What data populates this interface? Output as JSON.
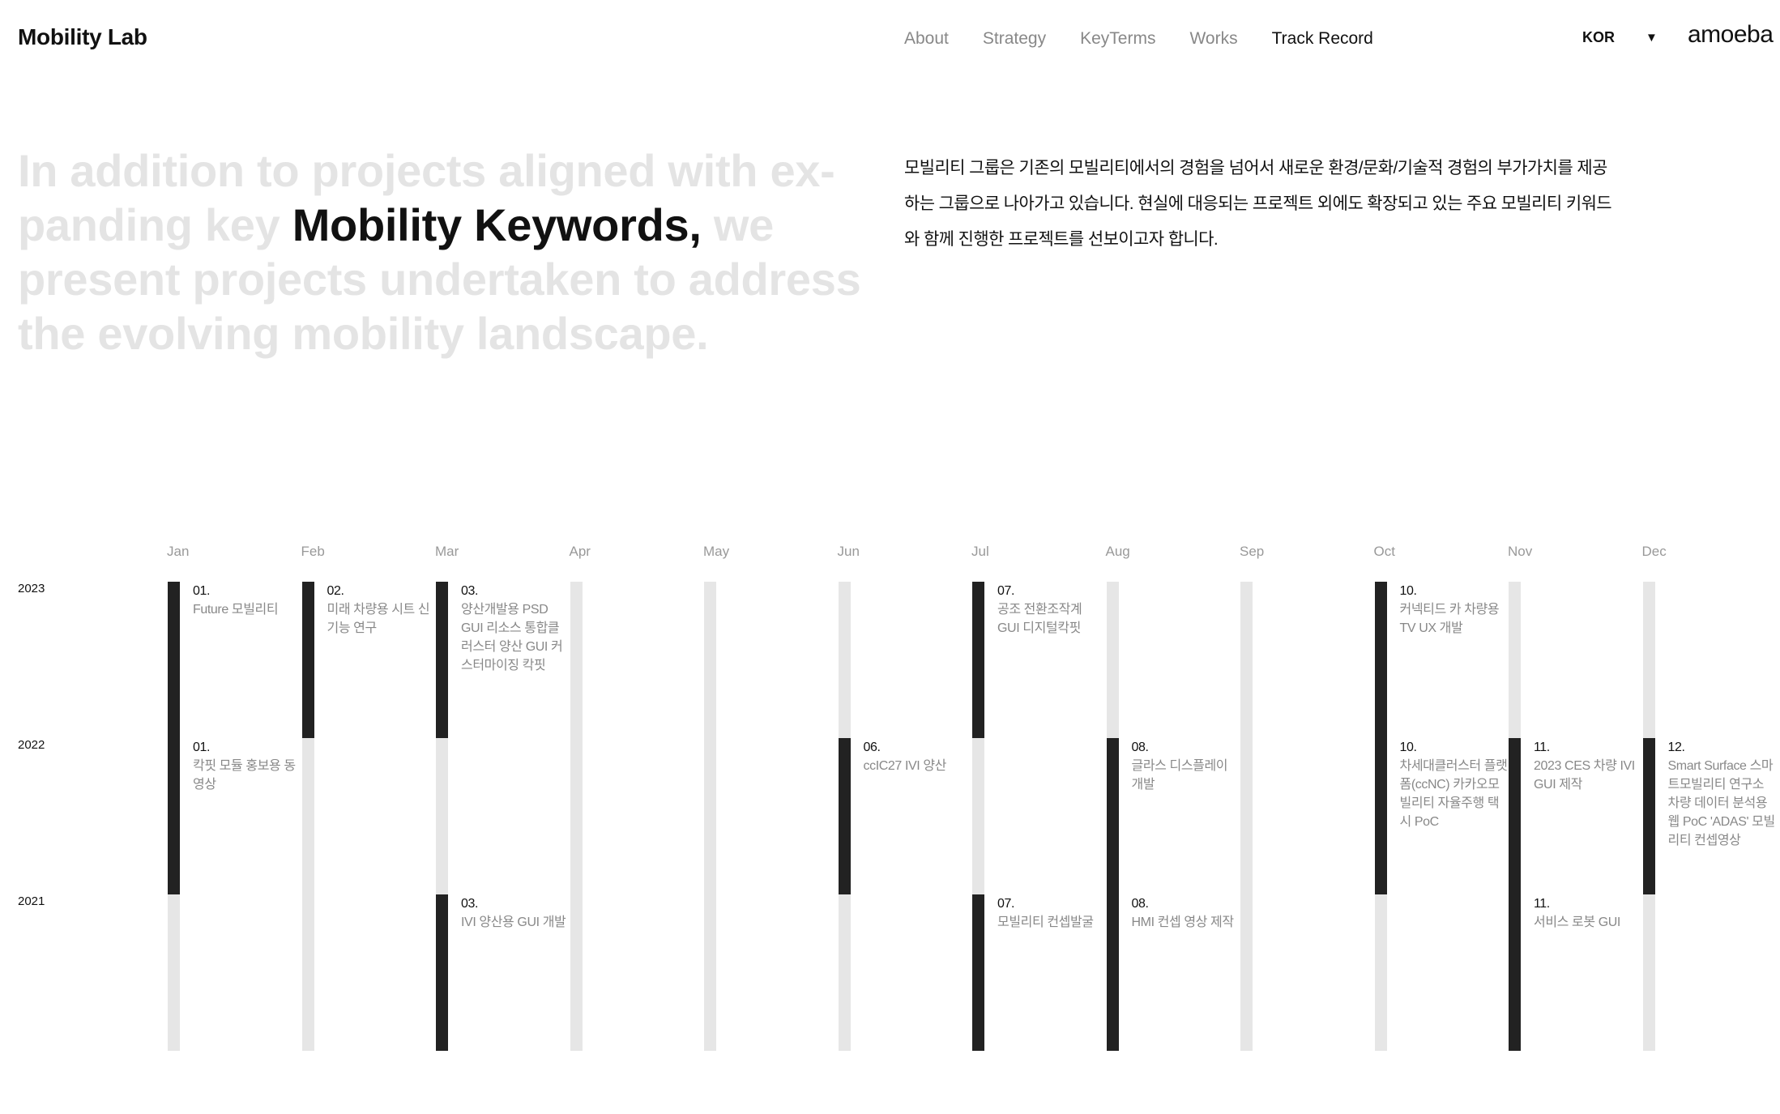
{
  "header": {
    "logo": "Mobility Lab",
    "nav": [
      {
        "label": "About",
        "active": false
      },
      {
        "label": "Strategy",
        "active": false
      },
      {
        "label": "KeyTerms",
        "active": false
      },
      {
        "label": "Works",
        "active": false
      },
      {
        "label": "Track Record",
        "active": true
      }
    ],
    "language": "KOR",
    "language_caret": "▼",
    "brand": "amoeba"
  },
  "intro": {
    "headline_before": "In addition to projects aligned with ex-panding key",
    "headline_emphasis": "Mobility Keywords,",
    "headline_after": "we present projects undertaken to address the evolving mobility landscape.",
    "description": "모빌리티 그룹은 기존의 모빌리티에서의 경험을 넘어서 새로운 환경/문화/기술적 경험의 부가가치를 제공하는 그룹으로 나아가고 있습니다. 현실에 대응되는 프로젝트 외에도 확장되고 있는 주요 모빌리티 키워드와 함께 진행한 프로젝트를 선보이고자 합니다."
  },
  "timeline": {
    "months": [
      "Jan",
      "Feb",
      "Mar",
      "Apr",
      "May",
      "Jun",
      "Jul",
      "Aug",
      "Sep",
      "Oct",
      "Nov",
      "Dec"
    ],
    "years": [
      "2023",
      "2022",
      "2021"
    ],
    "active_color": "#222222",
    "inactive_color": "#e6e6e6",
    "active": [
      [
        true,
        true,
        false
      ],
      [
        true,
        false,
        false
      ],
      [
        true,
        false,
        true
      ],
      [
        false,
        false,
        false
      ],
      [
        false,
        false,
        false
      ],
      [
        false,
        true,
        false
      ],
      [
        true,
        false,
        true
      ],
      [
        false,
        true,
        true
      ],
      [
        false,
        false,
        false
      ],
      [
        true,
        true,
        false
      ],
      [
        false,
        true,
        true
      ],
      [
        false,
        true,
        false
      ]
    ],
    "entries": [
      {
        "month": 0,
        "year": 0,
        "num": "01.",
        "text": "Future 모빌리티"
      },
      {
        "month": 0,
        "year": 1,
        "num": "01.",
        "text": "칵핏 모듈 홍보용 동영상"
      },
      {
        "month": 1,
        "year": 0,
        "num": "02.",
        "text": "미래 차량용 시트 신기능 연구"
      },
      {
        "month": 2,
        "year": 0,
        "num": "03.",
        "text": "양산개발용 PSD GUI 리소스 통합클러스터 양산 GUI 커스터마이징 칵핏"
      },
      {
        "month": 2,
        "year": 2,
        "num": "03.",
        "text": "IVI 양산용 GUI 개발"
      },
      {
        "month": 5,
        "year": 1,
        "num": "06.",
        "text": "ccIC27 IVI 양산"
      },
      {
        "month": 6,
        "year": 0,
        "num": "07.",
        "text": "공조 전환조작계 GUI 디지털칵핏"
      },
      {
        "month": 6,
        "year": 2,
        "num": "07.",
        "text": "모빌리티 컨셉발굴"
      },
      {
        "month": 7,
        "year": 1,
        "num": "08.",
        "text": "글라스 디스플레이 개발"
      },
      {
        "month": 7,
        "year": 2,
        "num": "08.",
        "text": "HMI 컨셉 영상 제작"
      },
      {
        "month": 9,
        "year": 0,
        "num": "10.",
        "text": "커넥티드 카 차량용 TV UX 개발"
      },
      {
        "month": 9,
        "year": 1,
        "num": "10.",
        "text": "차세대클러스터 플랫폼(ccNC) 카카오모빌리티 자율주행 택시 PoC"
      },
      {
        "month": 10,
        "year": 1,
        "num": "11.",
        "text": "2023 CES 차량 IVI GUI 제작"
      },
      {
        "month": 10,
        "year": 2,
        "num": "11.",
        "text": "서비스 로봇 GUI"
      },
      {
        "month": 11,
        "year": 1,
        "num": "12.",
        "text": "Smart Surface 스마트모빌리티 연구소 차량 데이터 분석용 웹 PoC 'ADAS' 모빌리티 컨셉영상"
      }
    ]
  }
}
